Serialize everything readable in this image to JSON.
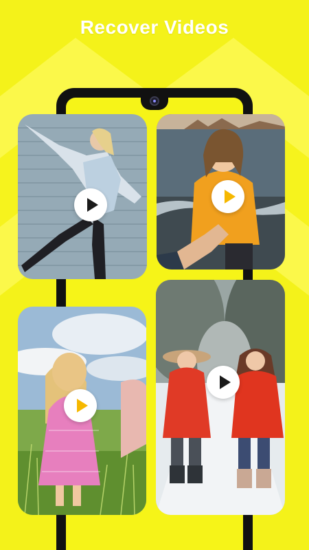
{
  "header": {
    "title": "Recover Videos"
  },
  "colors": {
    "background": "#f4f21a",
    "accent": "#f6b800"
  },
  "videos": [
    {
      "name": "video-thumbnail-wall-dancer",
      "icon": "play-icon"
    },
    {
      "name": "video-thumbnail-beach-hoodie",
      "icon": "play-icon"
    },
    {
      "name": "video-thumbnail-girl-meadow",
      "icon": "play-icon"
    },
    {
      "name": "video-thumbnail-kids-snow",
      "icon": "play-icon"
    }
  ]
}
